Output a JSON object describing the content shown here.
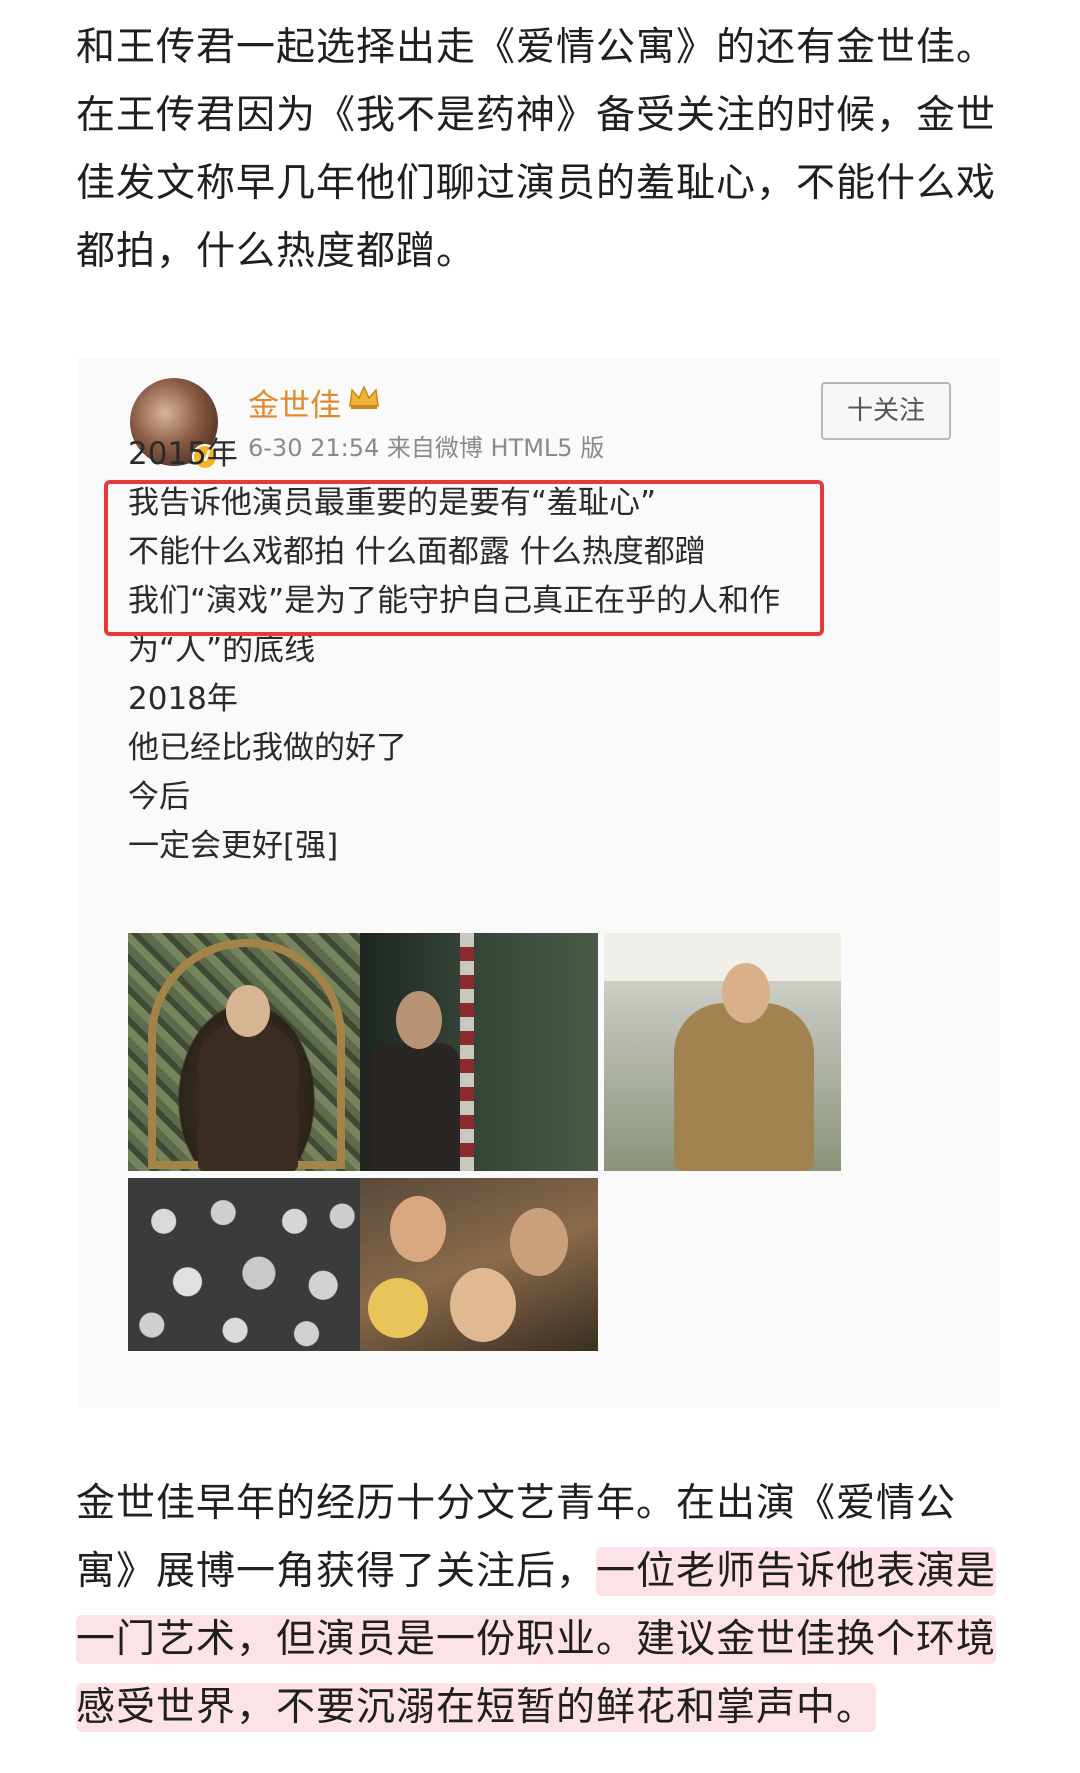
{
  "article": {
    "para1": "和王传君一起选择出走《爱情公寓》的还有金世佳。在王传君因为《我不是药神》备受关注的时候，金世佳发文称早几年他们聊过演员的羞耻心，不能什么戏都拍，什么热度都蹭。",
    "para2_plain": "金世佳早年的经历十分文艺青年。在出演《爱情公寓》展博一角获得了关注后，",
    "para2_highlight": "一位老师告诉他表演是一门艺术，但演员是一份职业。建议金世佳换个环境感受世界，不要沉溺在短暂的鲜花和掌声中。"
  },
  "weibo": {
    "username": "金世佳",
    "meta": "6-30 21:54  来自微博 HTML5 版",
    "follow_label": "十关注",
    "verify_mark": "V",
    "lines": [
      "2015年",
      "我告诉他演员最重要的是要有“羞耻心”",
      "不能什么戏都拍 什么面都露 什么热度都蹭",
      "我们“演戏”是为了能守护自己真正在乎的人和作",
      "为“人”的底线",
      "2018年",
      "他已经比我做的好了",
      "今后",
      "一定会更好[强]"
    ],
    "icons": {
      "crown": "crown-icon",
      "verified": "verified-badge-icon"
    },
    "colors": {
      "username": "#e08a2c",
      "box": "#e53a3a",
      "highlight": "#fde3e5"
    }
  }
}
